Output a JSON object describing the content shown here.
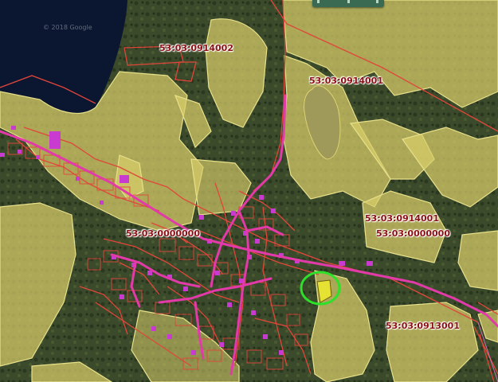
{
  "map": {
    "copyright": "© 2018 Google",
    "labels": [
      {
        "id": "l1",
        "text": "53:03:0914002"
      },
      {
        "id": "l2",
        "text": "53:03:0914001"
      },
      {
        "id": "l3",
        "text": "53:03:0914001"
      },
      {
        "id": "l4",
        "text": "53:03:0000000"
      },
      {
        "id": "l5",
        "text": "53:03:0000000"
      },
      {
        "id": "l6",
        "text": "53:03:0913001"
      }
    ],
    "colors": {
      "parcel_fill": "#d8cd6a",
      "parcel_stroke": "#e8e08a",
      "boundary": "#e0463a",
      "road": "#e23aa8",
      "water": "#0b1630",
      "highlight": "#2ee02a"
    }
  }
}
